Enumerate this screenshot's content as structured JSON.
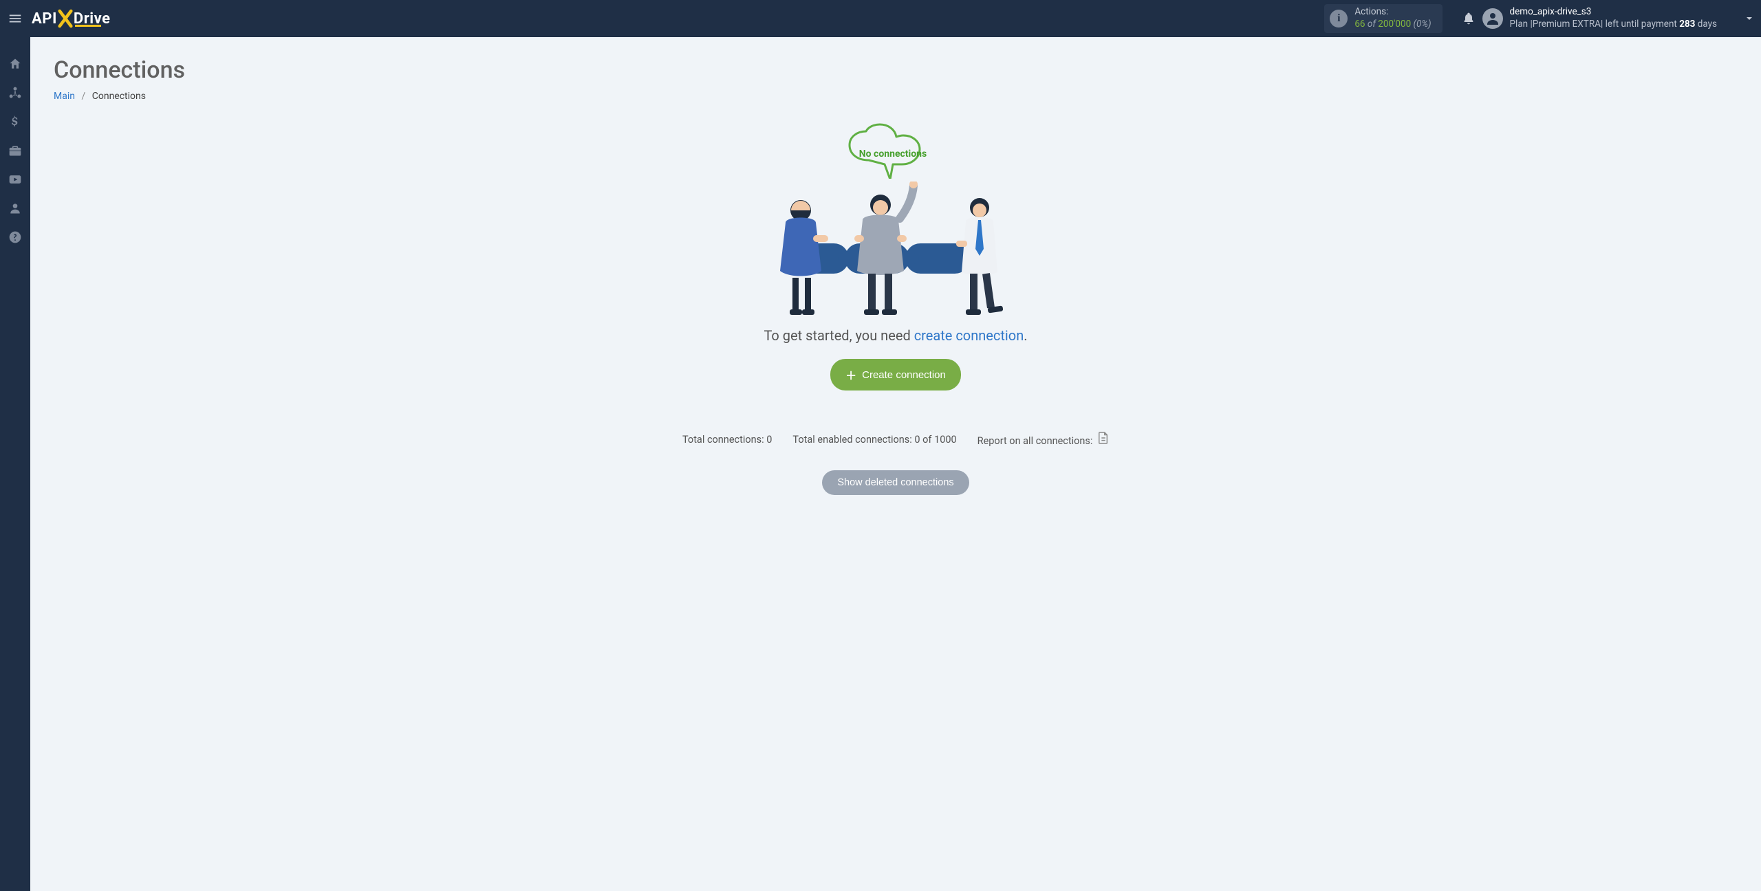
{
  "header": {
    "actions": {
      "label": "Actions:",
      "count": "66",
      "of_word": "of",
      "total": "200'000",
      "percent": "(0%)"
    },
    "user": {
      "name": "demo_apix-drive_s3",
      "plan_prefix": "Plan |",
      "plan_name": "Premium EXTRA",
      "plan_suffix_before_days": "| left until payment ",
      "days": "283",
      "days_suffix": " days"
    }
  },
  "sidebar": {
    "items": [
      {
        "name": "home"
      },
      {
        "name": "connections"
      },
      {
        "name": "billing"
      },
      {
        "name": "briefcase"
      },
      {
        "name": "video"
      },
      {
        "name": "account"
      },
      {
        "name": "help"
      }
    ]
  },
  "page": {
    "title": "Connections",
    "breadcrumb": {
      "main": "Main",
      "current": "Connections"
    },
    "empty": {
      "cloud_label": "No connections",
      "lead_before": "To get started, you need ",
      "lead_link": "create connection",
      "lead_after": ".",
      "create_button": "Create connection"
    },
    "stats": {
      "total_label": "Total connections:",
      "total_value": "0",
      "enabled_label": "Total enabled connections:",
      "enabled_value": "0 of 1000",
      "report_label": "Report on all connections:"
    },
    "show_deleted_button": "Show deleted connections"
  }
}
